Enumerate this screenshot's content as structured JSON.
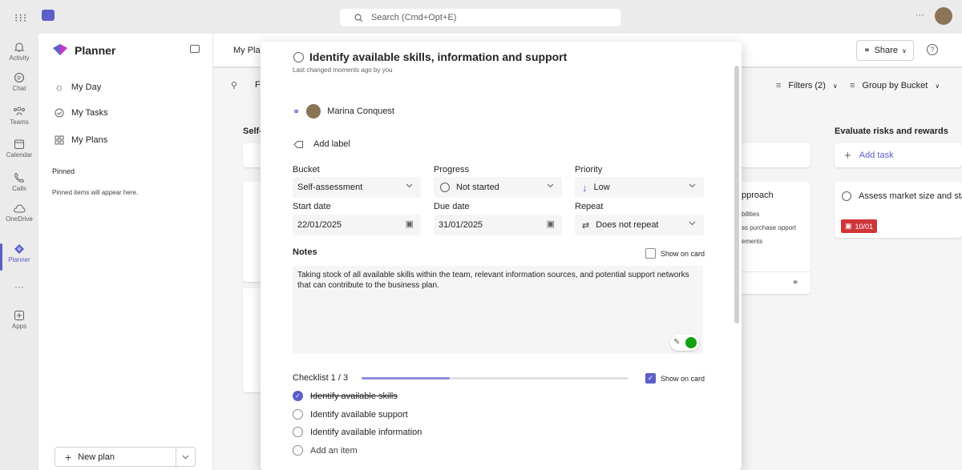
{
  "topbar": {
    "search_placeholder": "Search (Cmd+Opt+E)",
    "more": "···"
  },
  "rail": [
    {
      "label": "Activity",
      "icon": "bell-icon"
    },
    {
      "label": "Chat",
      "icon": "chat-icon"
    },
    {
      "label": "Teams",
      "icon": "teams-icon"
    },
    {
      "label": "Calendar",
      "icon": "calendar-icon"
    },
    {
      "label": "Calls",
      "icon": "phone-icon"
    },
    {
      "label": "OneDrive",
      "icon": "cloud-icon"
    },
    {
      "label": "Planner",
      "icon": "planner-icon"
    },
    {
      "label": "···",
      "icon": "more-icon"
    },
    {
      "label": "Apps",
      "icon": "apps-icon"
    }
  ],
  "nav": {
    "title": "Planner",
    "items": [
      {
        "label": "My Day",
        "icon": "sun-icon"
      },
      {
        "label": "My Tasks",
        "icon": "tasks-icon"
      },
      {
        "label": "My Plans",
        "icon": "grid-icon"
      }
    ],
    "pinned_heading": "Pinned",
    "pinned_empty": "Pinned items will appear here.",
    "new_plan": "New plan"
  },
  "header": {
    "tab_partial": "My Pla",
    "share": "Share",
    "filters": "Filters (2)",
    "group_by": "Group by Bucket"
  },
  "board": {
    "self_partial": "Self-",
    "search_partial": "F",
    "approach_card": {
      "title_partial": "pproach",
      "lines": [
        "bilities",
        "ss purchase opport",
        "ements"
      ]
    },
    "evaluate_bucket": {
      "title": "Evaluate risks and rewards",
      "add_task": "Add task",
      "task_title": "Assess market size and stab",
      "due": "10/01"
    }
  },
  "dialog": {
    "title": "Identify available skills, information and support",
    "subtitle": "Last changed moments ago by you",
    "assignee": "Marina Conquest",
    "add_label": "Add label",
    "bucket_label": "Bucket",
    "bucket_value": "Self-assessment",
    "progress_label": "Progress",
    "progress_value": "Not started",
    "priority_label": "Priority",
    "priority_value": "Low",
    "start_label": "Start date",
    "start_value": "22/01/2025",
    "due_label": "Due date",
    "due_value": "31/01/2025",
    "repeat_label": "Repeat",
    "repeat_value": "Does not repeat",
    "notes_label": "Notes",
    "show_on_card": "Show on card",
    "notes_text": "Taking stock of all available skills within the team, relevant information sources, and potential support networks that can contribute to the business plan.",
    "checklist_label": "Checklist 1 / 3",
    "checklist_progress": 0.33,
    "checklist": [
      {
        "label": "Identify available skills",
        "done": true
      },
      {
        "label": "Identify available support",
        "done": false
      },
      {
        "label": "Identify available information",
        "done": false
      }
    ],
    "add_item": "Add an item"
  },
  "colors": {
    "accent": "#5b5fc7",
    "overdue": "#d13438",
    "green": "#13a10e"
  }
}
